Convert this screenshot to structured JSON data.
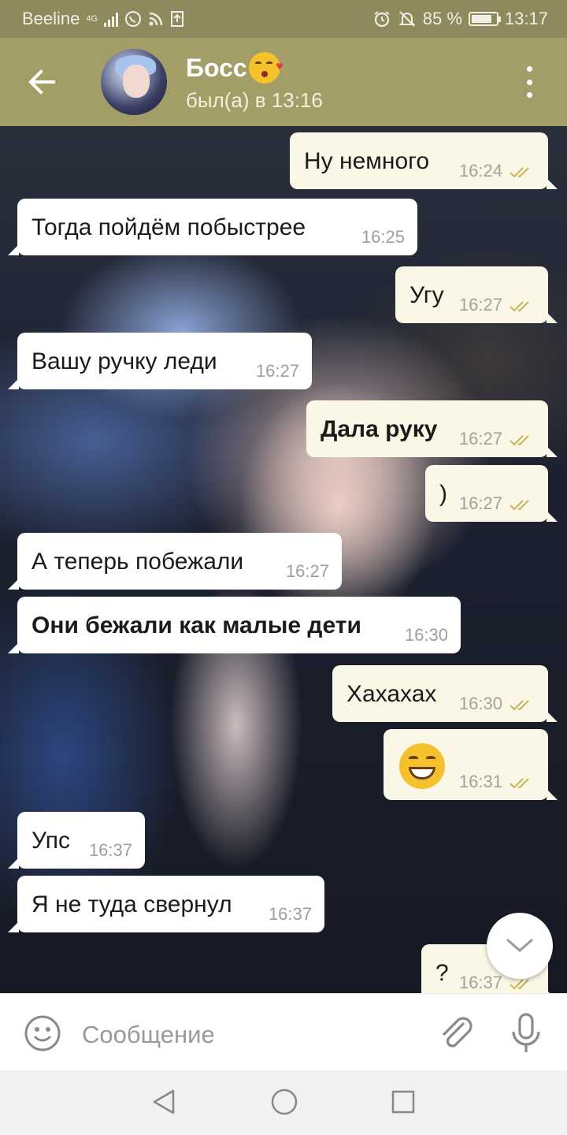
{
  "statusbar": {
    "carrier": "Beeline",
    "network": "4G",
    "battery": "85 %",
    "battery_level": 0.85,
    "time": "13:17",
    "icons": [
      "signal-icon",
      "whatsapp-icon",
      "rss-icon",
      "upload-icon",
      "alarm-icon",
      "mute-icon",
      "battery-icon"
    ]
  },
  "header": {
    "contact_name": "Босс",
    "contact_emoji": "kissing-heart-emoji",
    "status": "был(а) в 13:16"
  },
  "messages": [
    {
      "dir": "out",
      "text": "Ну немного",
      "time": "16:24",
      "read": true
    },
    {
      "dir": "in",
      "text": "Тогда пойдём побыстрее",
      "time": "16:25"
    },
    {
      "dir": "out",
      "text": "Угу",
      "time": "16:27",
      "read": true
    },
    {
      "dir": "in",
      "text": "Вашу ручку леди",
      "time": "16:27"
    },
    {
      "dir": "out",
      "text": "Дала руку",
      "time": "16:27",
      "read": true,
      "bold": true
    },
    {
      "dir": "out",
      "text": ")",
      "time": "16:27",
      "read": true
    },
    {
      "dir": "in",
      "text": "А теперь побежали",
      "time": "16:27"
    },
    {
      "dir": "in",
      "text": "Они бежали как малые дети",
      "time": "16:30",
      "bold": true
    },
    {
      "dir": "out",
      "text": "Хахахах",
      "time": "16:30",
      "read": true
    },
    {
      "dir": "out",
      "emoji": "grinning-emoji",
      "time": "16:31",
      "read": true
    },
    {
      "dir": "in",
      "text": "Упс",
      "time": "16:37"
    },
    {
      "dir": "in",
      "text": "Я не туда свернул",
      "time": "16:37"
    },
    {
      "dir": "out",
      "text": "?",
      "time": "16:37",
      "read": true
    }
  ],
  "input": {
    "placeholder": "Сообщение"
  },
  "colors": {
    "header": "#a39d67",
    "statusbar": "#8f8a5d",
    "outgoing_bubble": "#fbf7e6",
    "incoming_bubble": "#ffffff",
    "read_check": "#c9b455"
  }
}
